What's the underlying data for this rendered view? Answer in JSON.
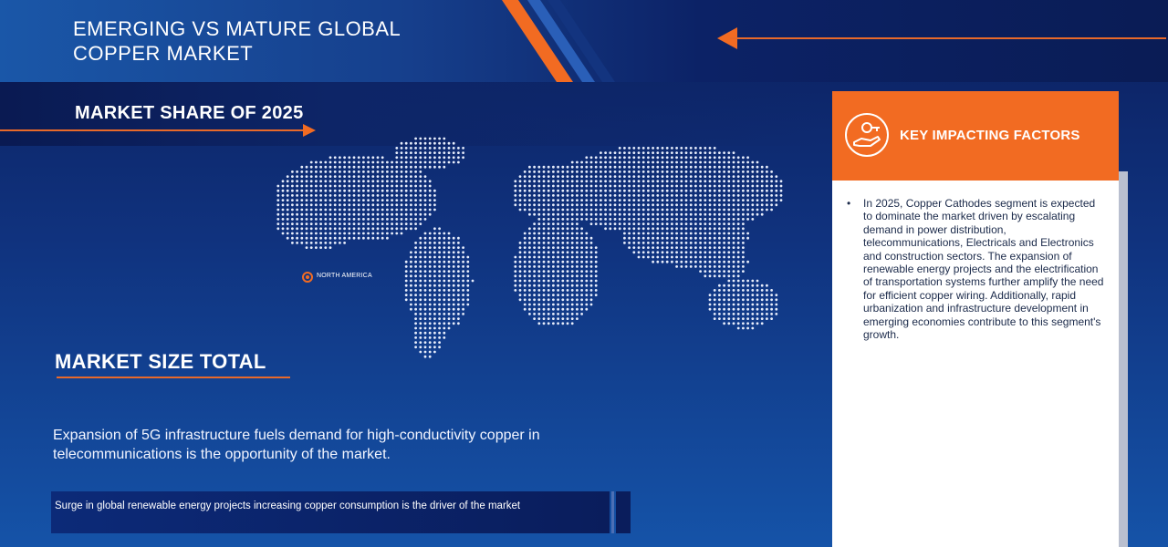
{
  "header": {
    "title": "EMERGING VS MATURE GLOBAL COPPER MARKET"
  },
  "share": {
    "title": "MARKET SHARE OF 2025"
  },
  "map": {
    "region_label": "NORTH AMERICA"
  },
  "size": {
    "title": "MARKET SIZE TOTAL"
  },
  "opportunity": {
    "text": "Expansion of 5G infrastructure fuels demand for high-conductivity copper in telecommunications is the opportunity of the market."
  },
  "driver": {
    "text": "Surge in global renewable energy projects increasing copper consumption is the driver of the market"
  },
  "key_factors": {
    "title": "KEY IMPACTING FACTORS",
    "items": [
      "In 2025, Copper Cathodes segment is expected to dominate the market driven by escalating demand in power distribution, telecommunications, Electricals and Electronics and construction sectors. The expansion of renewable energy projects and the electrification of transportation systems further amplify the need for efficient copper wiring. Additionally, rapid urbanization and infrastructure development in emerging economies contribute to this segment's growth."
    ]
  },
  "colors": {
    "accent": "#f26b22",
    "navy": "#0b1f5e",
    "blue": "#1553a8"
  }
}
